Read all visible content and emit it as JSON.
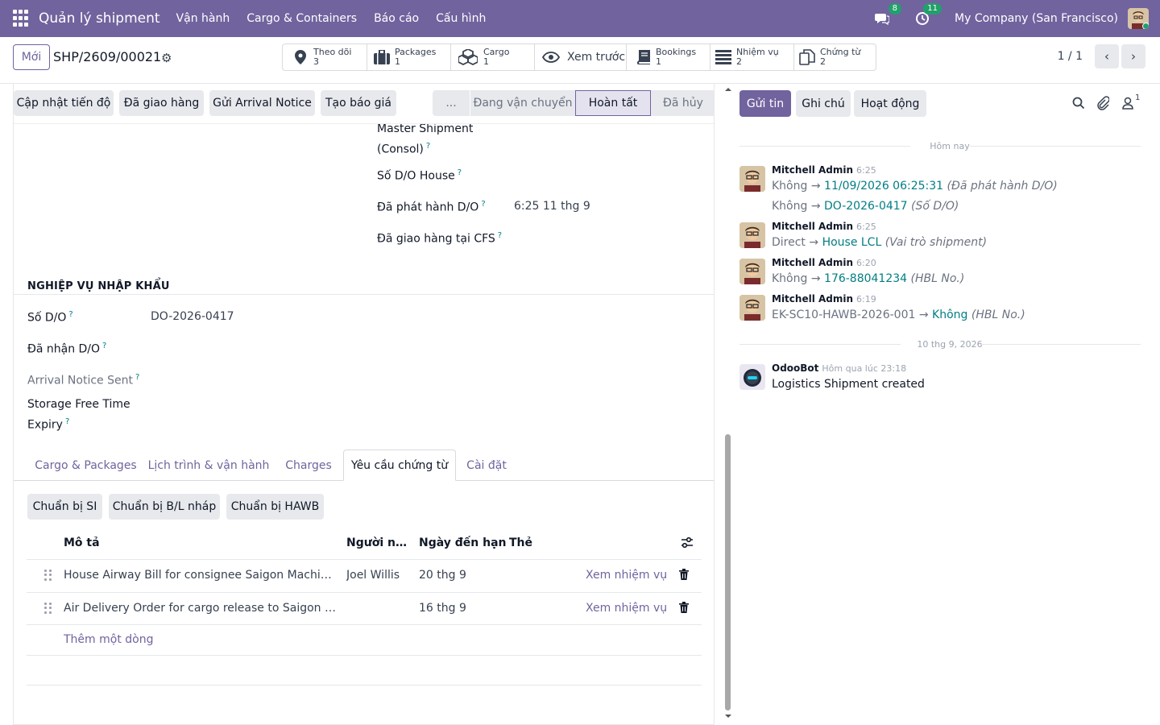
{
  "navbar": {
    "brand": "Quản lý shipment",
    "menus": [
      "Vận hành",
      "Cargo & Containers",
      "Báo cáo",
      "Cấu hình"
    ],
    "messages_count": "8",
    "activity_count": "11",
    "company": "My Company (San Francisco)"
  },
  "control_panel": {
    "new_label": "Mới",
    "record_name": "SHP/2609/00021",
    "pager": "1 / 1",
    "smart_buttons": [
      {
        "label": "Theo dõi",
        "count": "3",
        "icon": "location-pin-icon"
      },
      {
        "label": "Packages",
        "count": "1",
        "icon": "suitcase-icon"
      },
      {
        "label": "Cargo",
        "count": "1",
        "icon": "cubes-icon"
      },
      {
        "label": "Xem trước",
        "count": "",
        "icon": "eye-icon"
      },
      {
        "label": "Bookings",
        "count": "1",
        "icon": "book-icon"
      },
      {
        "label": "Nhiệm vụ",
        "count": "2",
        "icon": "tasks-icon"
      },
      {
        "label": "Chứng từ",
        "count": "2",
        "icon": "copy-icon"
      }
    ]
  },
  "statusbar": {
    "buttons": [
      "Cập nhật tiến độ",
      "Đã giao hàng",
      "Gửi Arrival Notice",
      "Tạo báo giá"
    ],
    "stages": [
      "...",
      "Đang vận chuyển",
      "Hoàn tất",
      "Đã hủy"
    ],
    "active_stage": "Hoàn tất"
  },
  "fields_top": {
    "master_shipment": "Master Shipment (Consol)",
    "do_house": "Số D/O House",
    "do_issued": "Đã phát hành D/O",
    "do_issued_value": "6:25 11 thg 9",
    "cfs_delivered": "Đã giao hàng tại CFS"
  },
  "import_section": {
    "title": "NGHIỆP VỤ NHẬP KHẨU",
    "do_number_label": "Số D/O",
    "do_number_value": "DO-2026-0417",
    "do_received_label": "Đã nhận D/O",
    "arrival_notice_label": "Arrival Notice Sent",
    "storage_label": "Storage Free Time Expiry"
  },
  "tabs": [
    "Cargo & Packages",
    "Lịch trình & vận hành",
    "Charges",
    "Yêu cầu chứng từ",
    "Cài đặt"
  ],
  "active_tab": "Yêu cầu chứng từ",
  "doc_actions": [
    "Chuẩn bị SI",
    "Chuẩn bị B/L nháp",
    "Chuẩn bị HAWB"
  ],
  "table": {
    "headers": [
      "Mô tả",
      "Người nhậ...",
      "Ngày đến hạn",
      "Thẻ"
    ],
    "rows": [
      {
        "description": "House Airway Bill for consignee Saigon Machinery Co., Ltd.",
        "assignee": "Joel Willis",
        "due": "20 thg 9",
        "action": "Xem nhiệm vụ"
      },
      {
        "description": "Air Delivery Order for cargo release to Saigon Machinery Co., Ltd.",
        "assignee": "",
        "due": "16 thg 9",
        "action": "Xem nhiệm vụ"
      }
    ],
    "add_line": "Thêm một dòng"
  },
  "chatter": {
    "send_label": "Gửi tin",
    "note_label": "Ghi chú",
    "activity_label": "Hoạt động",
    "followers_count": "1",
    "today": "Hôm nay",
    "older_date": "10 thg 9, 2026",
    "messages": [
      {
        "author": "Mitchell Admin",
        "time": "6:25",
        "changes": [
          {
            "old": "Không",
            "new": "11/09/2026 06:25:31",
            "field": "(Đã phát hành D/O)"
          },
          {
            "old": "Không",
            "new": "DO-2026-0417",
            "field": "(Số D/O)"
          }
        ]
      },
      {
        "author": "Mitchell Admin",
        "time": "6:25",
        "changes": [
          {
            "old": "Direct",
            "new": "House LCL",
            "field": "(Vai trò shipment)"
          }
        ]
      },
      {
        "author": "Mitchell Admin",
        "time": "6:20",
        "changes": [
          {
            "old": "Không",
            "new": "176-88041234",
            "field": "(HBL No.)"
          }
        ]
      },
      {
        "author": "Mitchell Admin",
        "time": "6:19",
        "changes": [
          {
            "old": "EK-SC10-HAWB-2026-001",
            "new": "Không",
            "field": "(HBL No.)"
          }
        ]
      }
    ],
    "bot": {
      "author": "OdooBot",
      "time": "Hôm qua lúc 23:18",
      "body": "Logistics Shipment created"
    }
  },
  "colors": {
    "brand": "#71639e",
    "link": "#017e84",
    "success": "#22a06b"
  }
}
